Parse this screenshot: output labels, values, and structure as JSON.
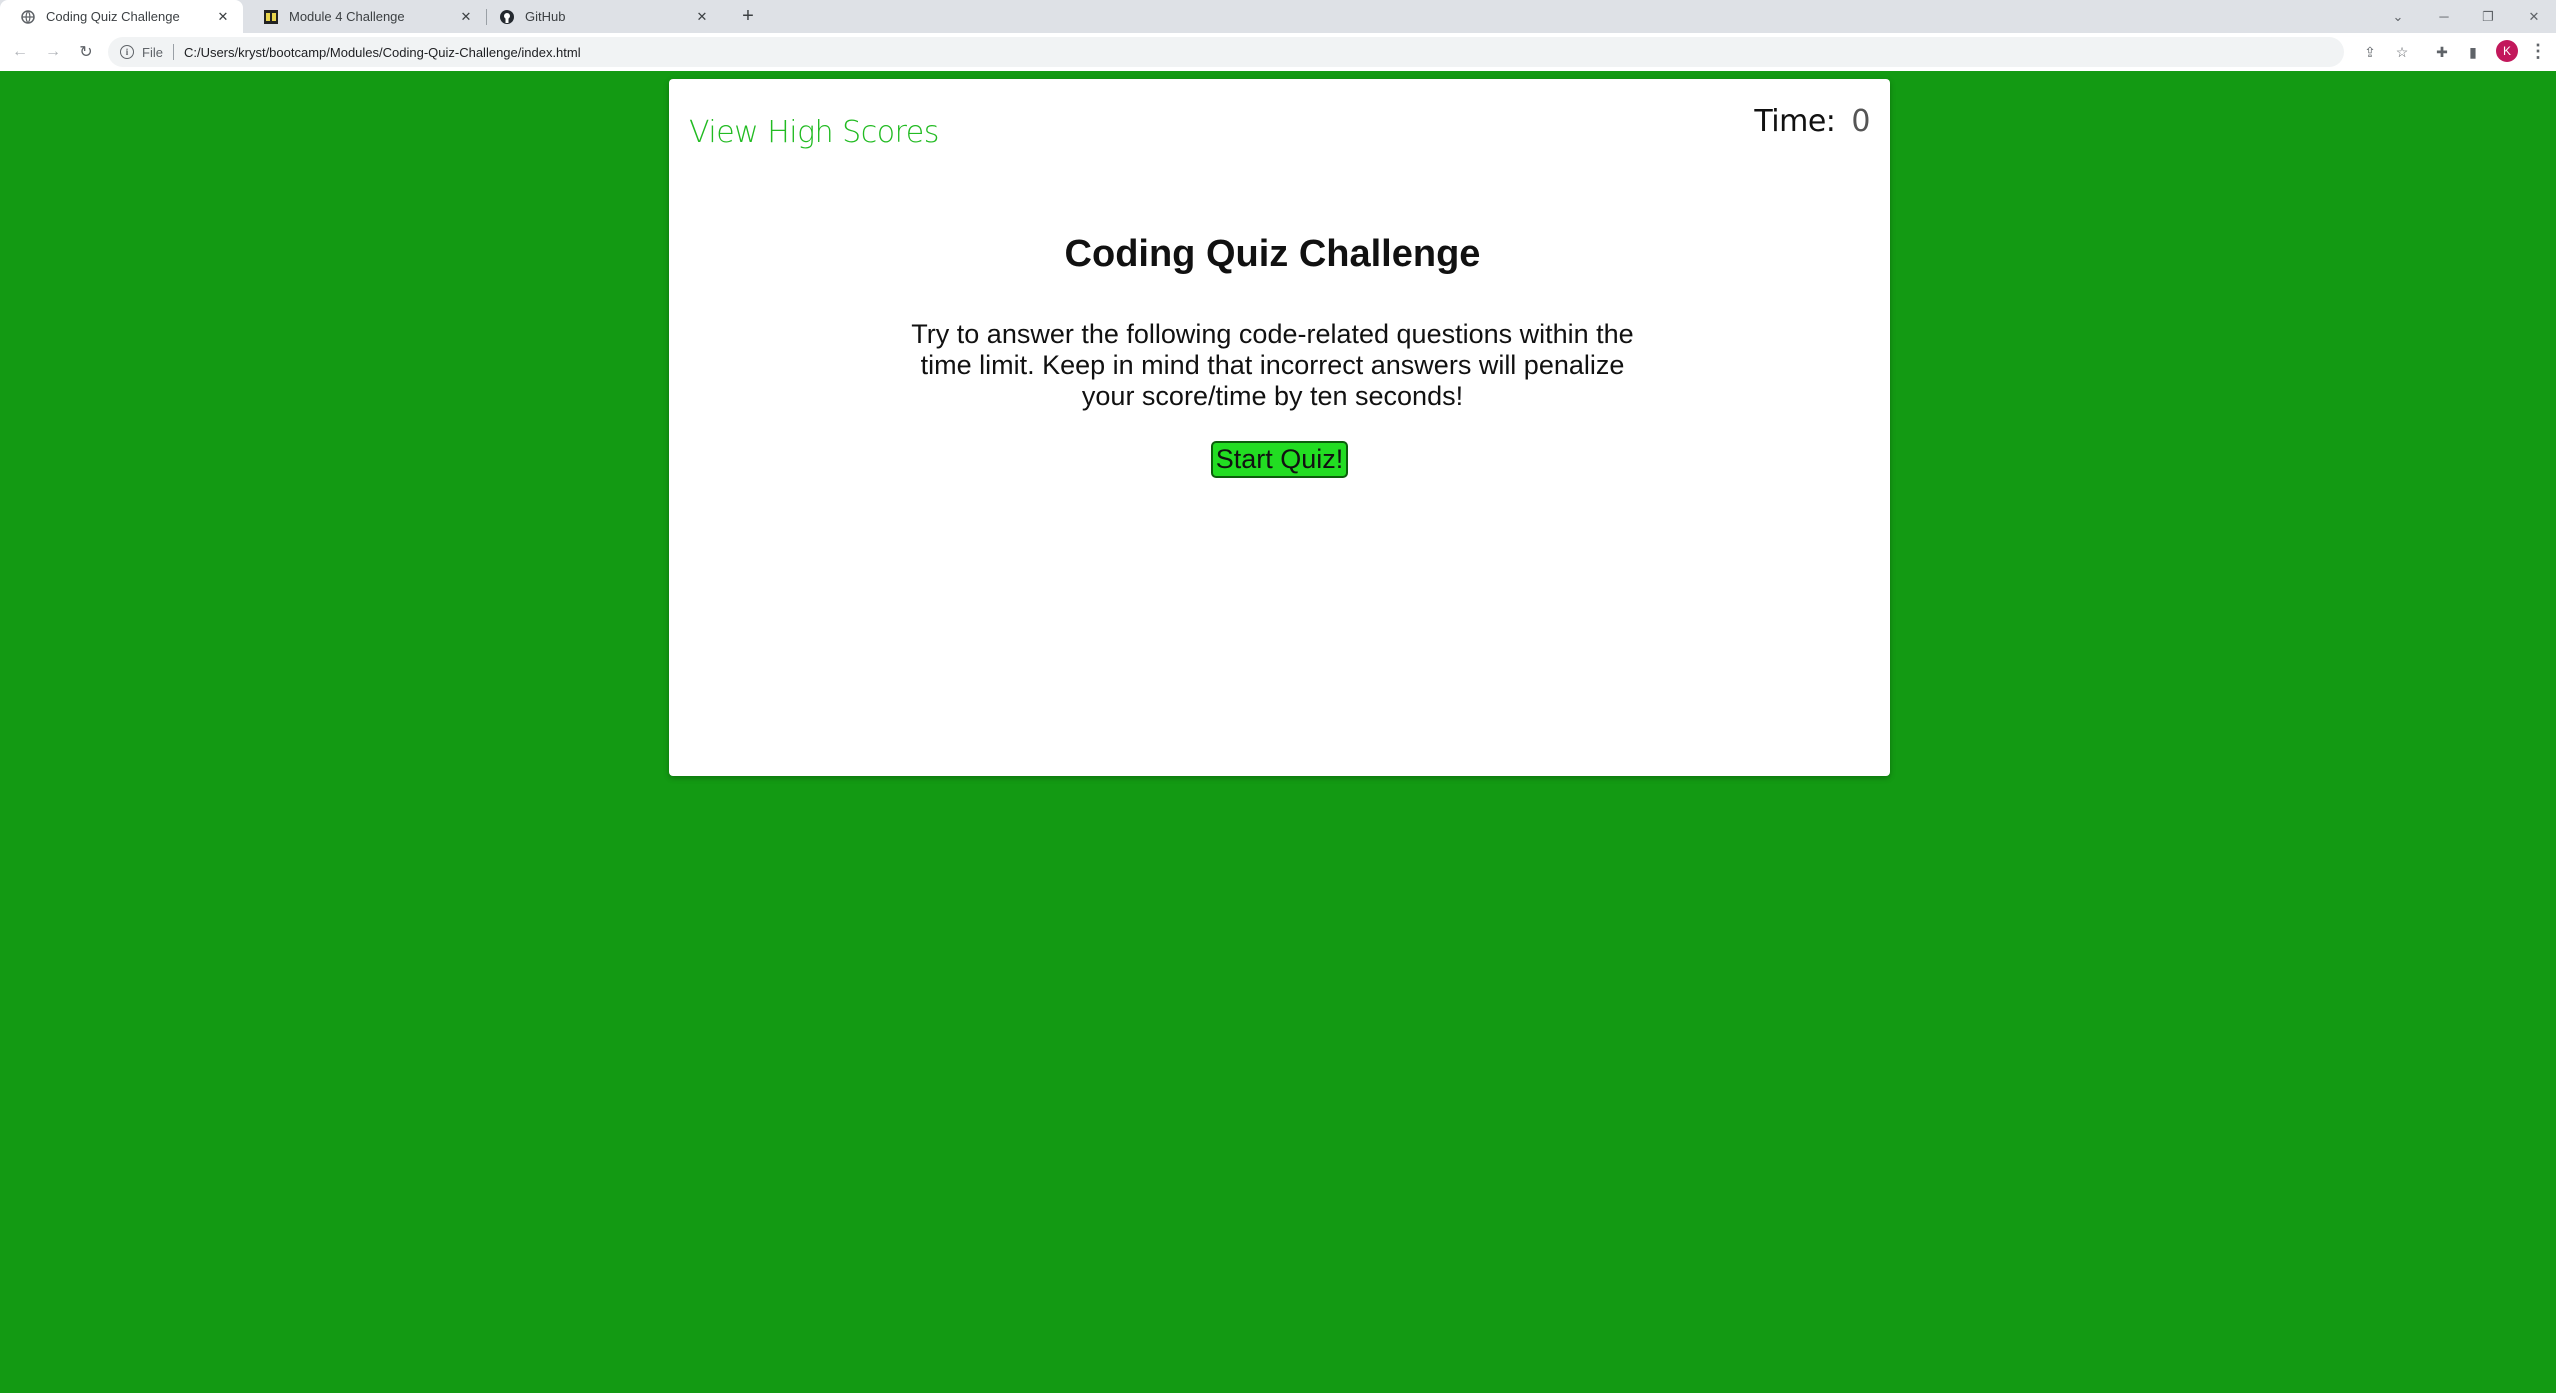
{
  "browser": {
    "tabs": [
      {
        "label": "Coding Quiz Challenge",
        "icon": "globe-icon",
        "active": true
      },
      {
        "label": "Module 4 Challenge",
        "icon": "bootcamp-logo-icon",
        "active": false
      },
      {
        "label": "GitHub",
        "icon": "github-icon",
        "active": false
      }
    ],
    "address": {
      "scheme": "File",
      "url": "C:/Users/kryst/bootcamp/Modules/Coding-Quiz-Challenge/index.html"
    },
    "profile_initial": "K"
  },
  "page": {
    "high_scores_link": "View High Scores",
    "timer_label": "Time:",
    "timer_value": "0",
    "title": "Coding Quiz Challenge",
    "intro": "Try to answer the following code-related questions within the time limit. Keep in mind that incorrect answers will penalize your score/time by ten seconds!",
    "start_button": "Start Quiz!"
  },
  "colors": {
    "background": "#139a13",
    "accent_link": "#22bb22",
    "start_button": "#22dd22"
  }
}
